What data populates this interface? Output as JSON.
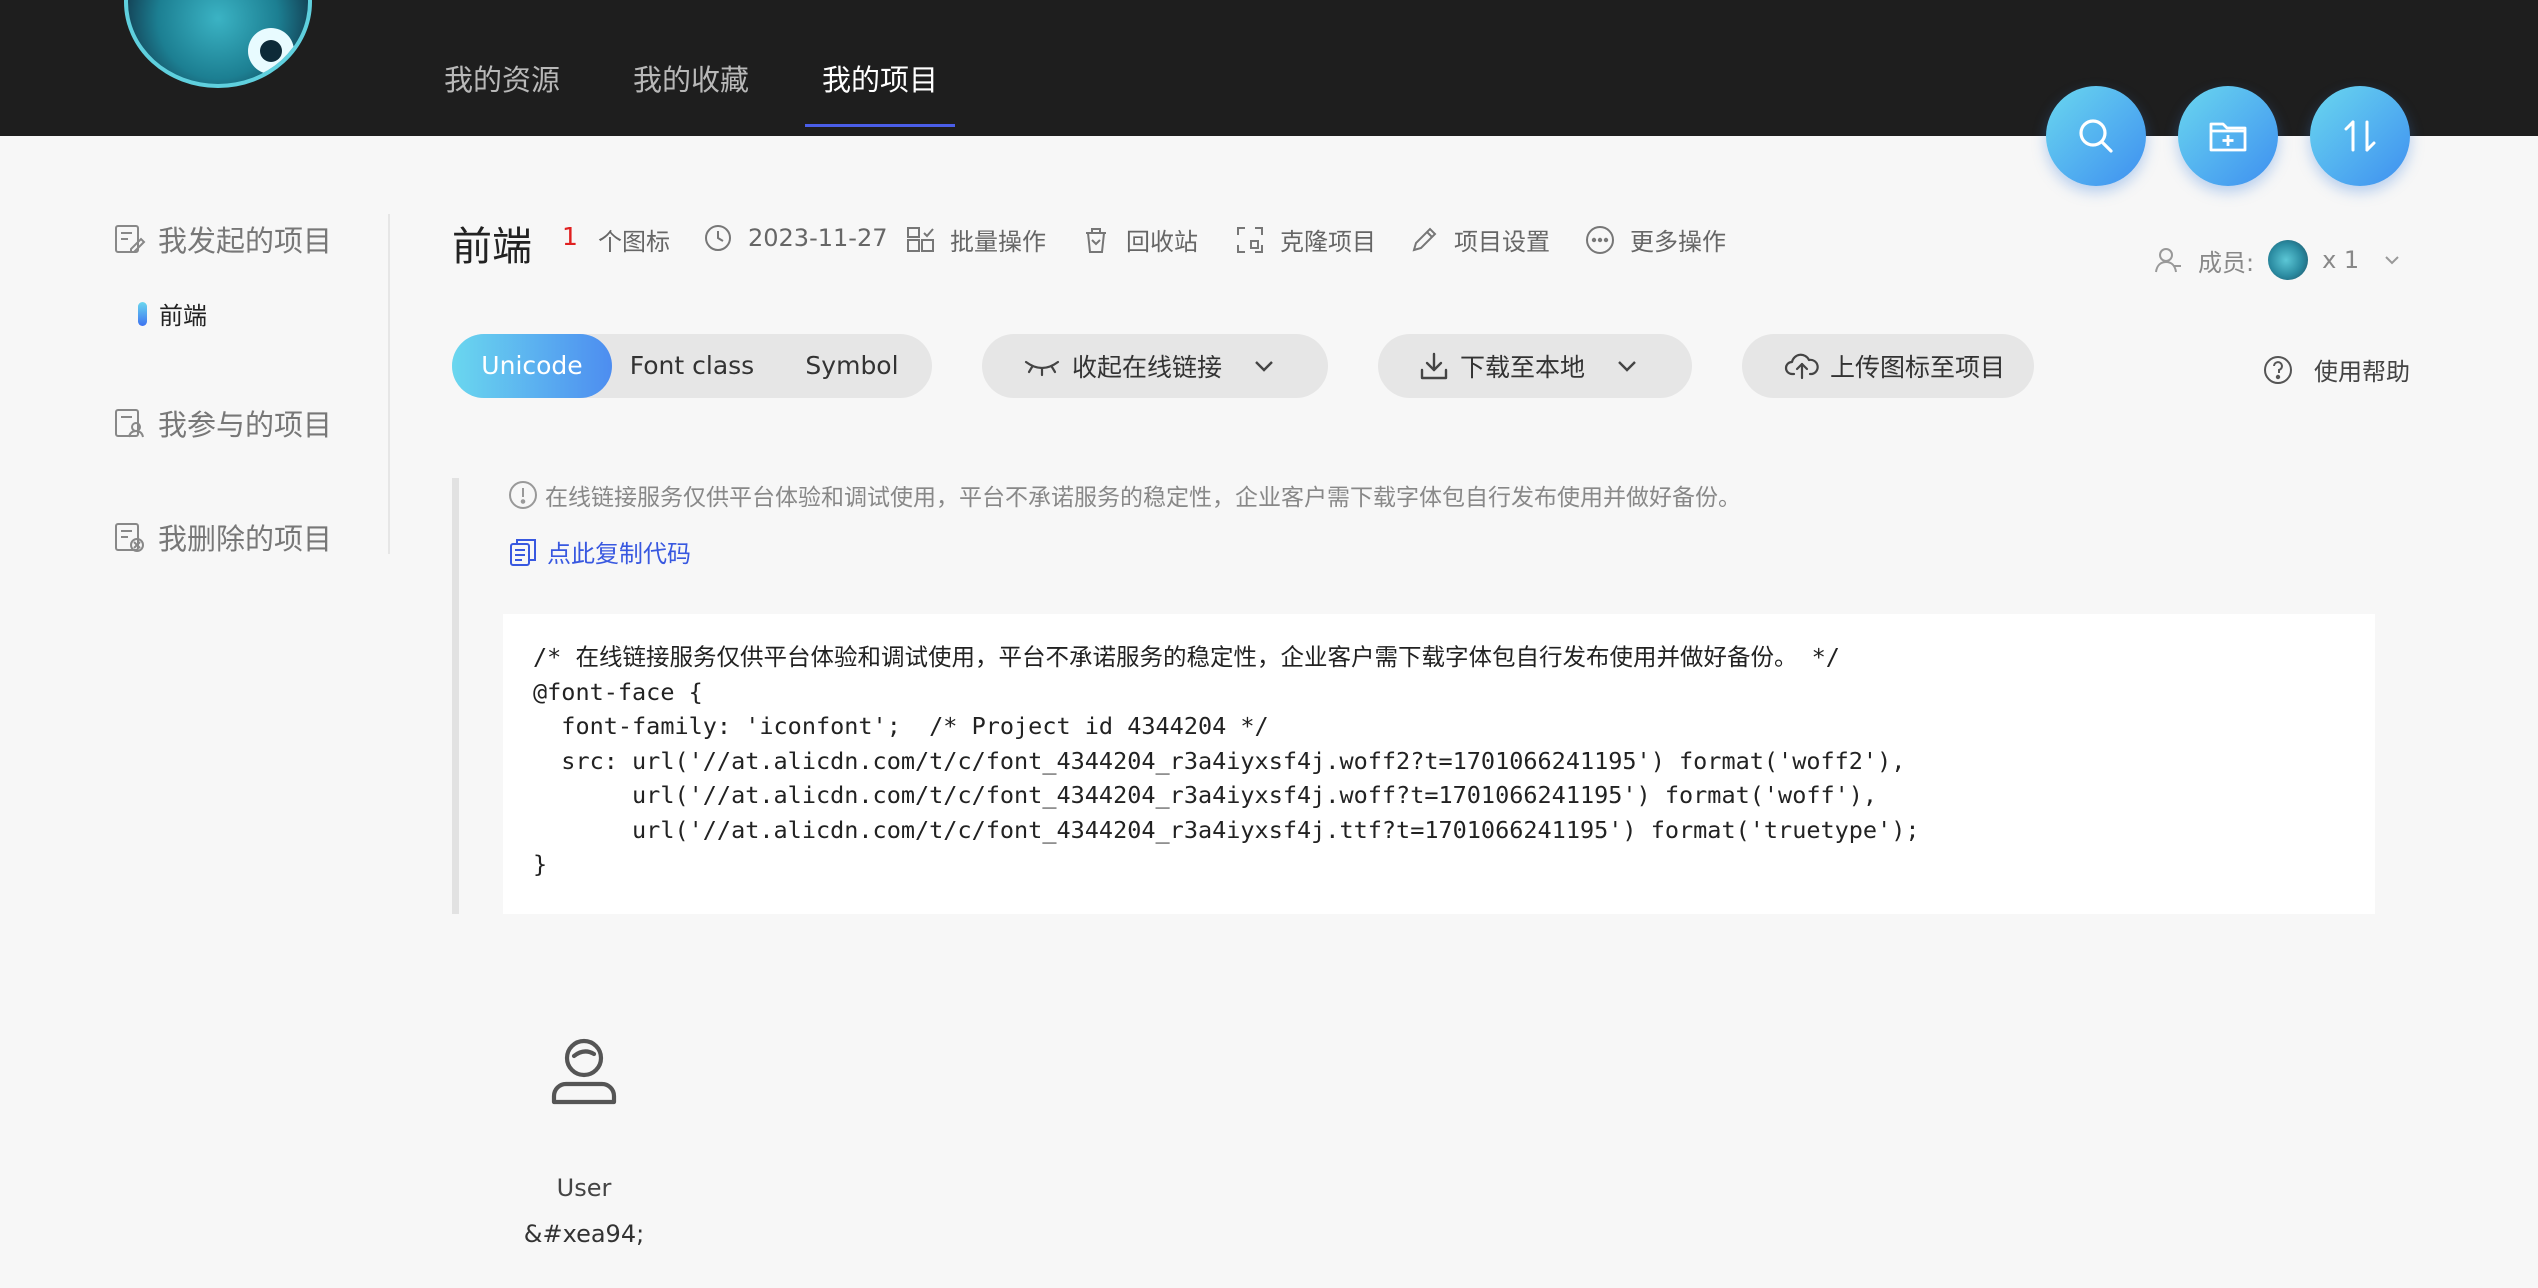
{
  "nav": {
    "items": [
      "我的资源",
      "我的收藏",
      "我的项目"
    ],
    "active_index": 2
  },
  "actions": {
    "search_icon": "search-icon",
    "new_folder_icon": "folder-plus-icon",
    "sort_icon": "sort-icon"
  },
  "sidebar": {
    "initiated": "我发起的项目",
    "current_project": "前端",
    "participated": "我参与的项目",
    "deleted": "我删除的项目"
  },
  "project": {
    "name": "前端",
    "icon_count": "1",
    "icon_count_label": "个图标",
    "date": "2023-11-27",
    "batch": "批量操作",
    "recycle": "回收站",
    "clone": "克隆项目",
    "settings": "项目设置",
    "more": "更多操作",
    "members_label": "成员:",
    "members_count": "x 1"
  },
  "toolbar": {
    "tabs": [
      "Unicode",
      "Font class",
      "Symbol"
    ],
    "active_tab": "Unicode",
    "collapse_link": "收起在线链接",
    "download": "下载至本地",
    "upload": "上传图标至项目",
    "help": "使用帮助"
  },
  "notice": {
    "text": "在线链接服务仅供平台体验和调试使用，平台不承诺服务的稳定性，企业客户需下载字体包自行发布使用并做好备份。",
    "copy": "点此复制代码"
  },
  "code": {
    "lines": [
      "/* 在线链接服务仅供平台体验和调试使用，平台不承诺服务的稳定性，企业客户需下载字体包自行发布使用并做好备份。 */",
      "@font-face {",
      "  font-family: 'iconfont';  /* Project id 4344204 */",
      "  src: url('//at.alicdn.com/t/c/font_4344204_r3a4iyxsf4j.woff2?t=1701066241195') format('woff2'),",
      "       url('//at.alicdn.com/t/c/font_4344204_r3a4iyxsf4j.woff?t=1701066241195') format('woff'),",
      "       url('//at.alicdn.com/t/c/font_4344204_r3a4iyxsf4j.ttf?t=1701066241195') format('truetype');",
      "}"
    ]
  },
  "icons": [
    {
      "name": "User",
      "code": "&#xea94;",
      "glyph": "user-icon"
    }
  ],
  "colors": {
    "accent_start": "#6ad7ef",
    "accent_end": "#3e8ff0",
    "link": "#3858e0",
    "count": "#e02020",
    "topbar": "#1e1e1e"
  }
}
